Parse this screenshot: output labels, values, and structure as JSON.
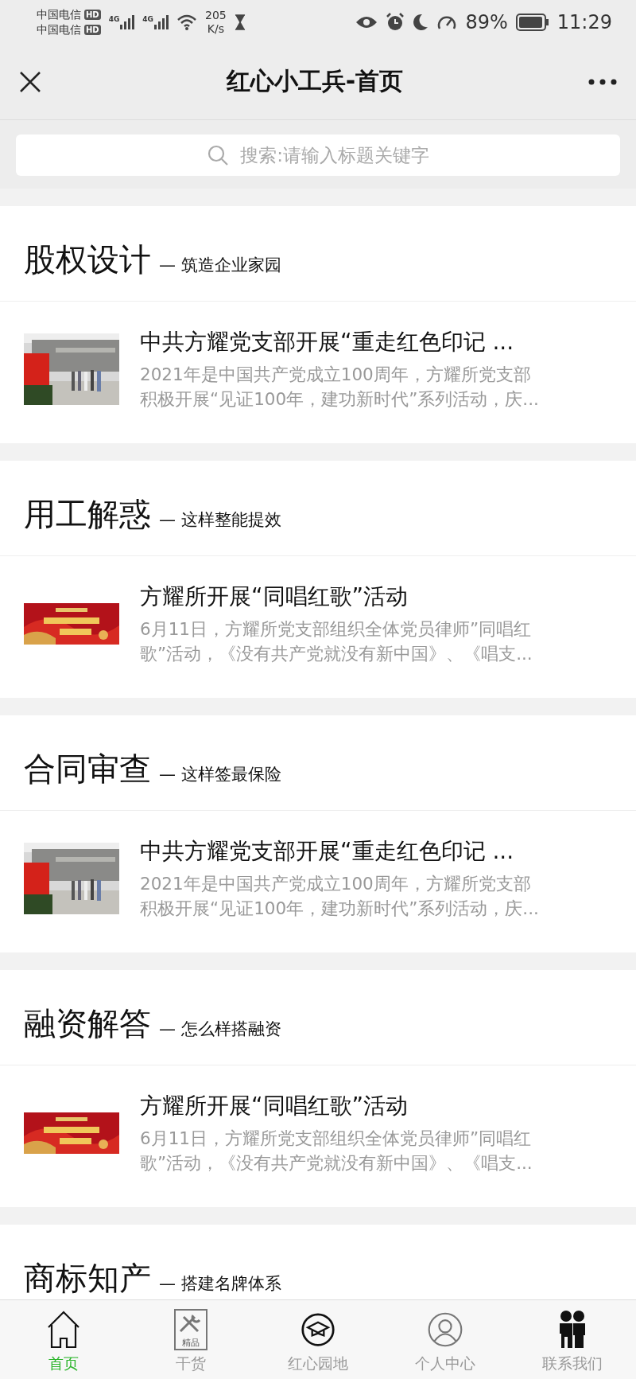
{
  "status_bar": {
    "carriers": [
      {
        "name": "中国电信",
        "badge": "HD",
        "network": "4G"
      },
      {
        "name": "中国电信",
        "badge": "HD",
        "network": "4G"
      }
    ],
    "speed_value": "205",
    "speed_unit": "K/s",
    "battery": "89%",
    "time": "11:29"
  },
  "nav_bar": {
    "title": "红心小工兵-首页"
  },
  "search": {
    "placeholder": "搜索:请输入标题关键字"
  },
  "sections": [
    {
      "title": "股权设计",
      "subtitle": "— 筑造企业家园",
      "articles": [
        {
          "title": "中共方耀党支部开展“重走红色印记 ...",
          "excerpt_lines": [
            "2021年是中国共产党成立100周年，方耀所党支部",
            "积极开展“见证100年，建功新时代”系列活动，庆..."
          ]
        }
      ]
    },
    {
      "title": "用工解惑",
      "subtitle": "— 这样整能提效",
      "articles": [
        {
          "title": "方耀所开展“同唱红歌”活动",
          "excerpt_lines": [
            "6月11日，方耀所党支部组织全体党员律师”同唱红",
            "歌”活动，《没有共产党就没有新中国》、《唱支..."
          ]
        }
      ]
    },
    {
      "title": "合同审查",
      "subtitle": "— 这样签最保险",
      "articles": [
        {
          "title": "中共方耀党支部开展“重走红色印记 ...",
          "excerpt_lines": [
            "2021年是中国共产党成立100周年，方耀所党支部",
            "积极开展“见证100年，建功新时代”系列活动，庆..."
          ]
        }
      ]
    },
    {
      "title": "融资解答",
      "subtitle": "— 怎么样搭融资",
      "articles": [
        {
          "title": "方耀所开展“同唱红歌”活动",
          "excerpt_lines": [
            "6月11日，方耀所党支部组织全体党员律师”同唱红",
            "歌”活动，《没有共产党就没有新中国》、《唱支..."
          ]
        }
      ]
    },
    {
      "title": "商标知产",
      "subtitle": "— 搭建名牌体系"
    }
  ],
  "tab_bar": [
    {
      "label": "首页",
      "kind": "home",
      "selected": true
    },
    {
      "label": "干货",
      "kind": "tools",
      "badge": "精品",
      "selected": false
    },
    {
      "label": "红心园地",
      "kind": "cap",
      "selected": false
    },
    {
      "label": "个人中心",
      "kind": "person",
      "selected": false
    },
    {
      "label": "联系我们",
      "kind": "people",
      "selected": false
    }
  ]
}
